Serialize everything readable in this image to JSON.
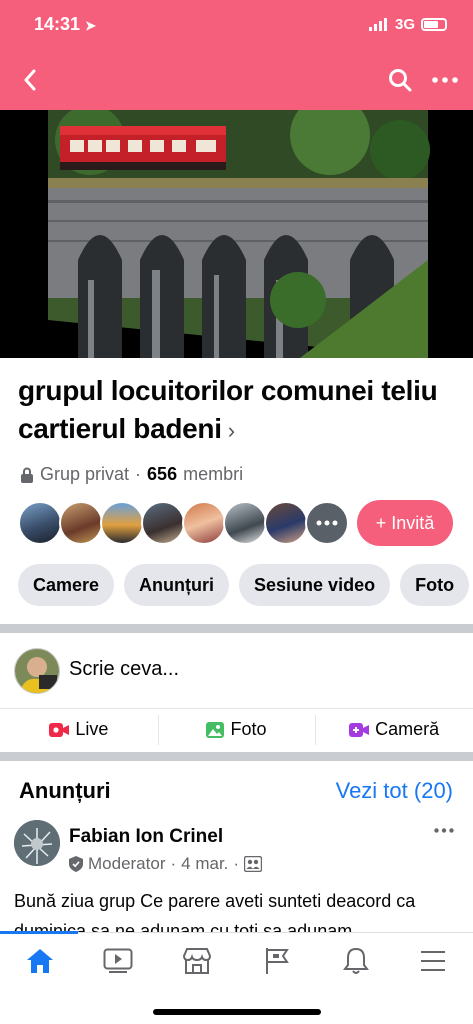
{
  "status_bar": {
    "time": "14:31",
    "network": "3G"
  },
  "header": {
    "back_icon": "chevron-left-icon",
    "search_icon": "search-icon",
    "more_icon": "more-dots-icon"
  },
  "group": {
    "title": "grupul locuitorilor comunei teliu cartierul badeni",
    "chevron": "›",
    "privacy": "Grup privat",
    "separator": "·",
    "member_count": "656",
    "members_label": "membri"
  },
  "invite_button": {
    "label": "+ Invită"
  },
  "tabs": [
    "Camere",
    "Anunțuri",
    "Sesiune video",
    "Foto"
  ],
  "composer": {
    "placeholder": "Scrie ceva..."
  },
  "actions": [
    {
      "label": "Live",
      "icon": "live-video-icon",
      "color": "#f02849"
    },
    {
      "label": "Foto",
      "icon": "photo-icon",
      "color": "#45bd62"
    },
    {
      "label": "Cameră",
      "icon": "room-camera-icon",
      "color": "#a33be0"
    }
  ],
  "announcements": {
    "title": "Anunțuri",
    "see_all": "Vezi tot (20)"
  },
  "post": {
    "author": "Fabian Ion Crinel",
    "role": "Moderator",
    "date": "4 mar.",
    "dot": "·",
    "text": "Bună ziua grup Ce parere aveti sunteti deacord ca  duminica sa ne adunam cu toti sa adunam"
  },
  "bottom_nav": [
    "home-icon",
    "video-icon",
    "marketplace-icon",
    "pages-flag-icon",
    "notifications-bell-icon",
    "menu-icon"
  ],
  "colors": {
    "brand_pink": "#f55f7b",
    "link_blue": "#1877f2"
  }
}
